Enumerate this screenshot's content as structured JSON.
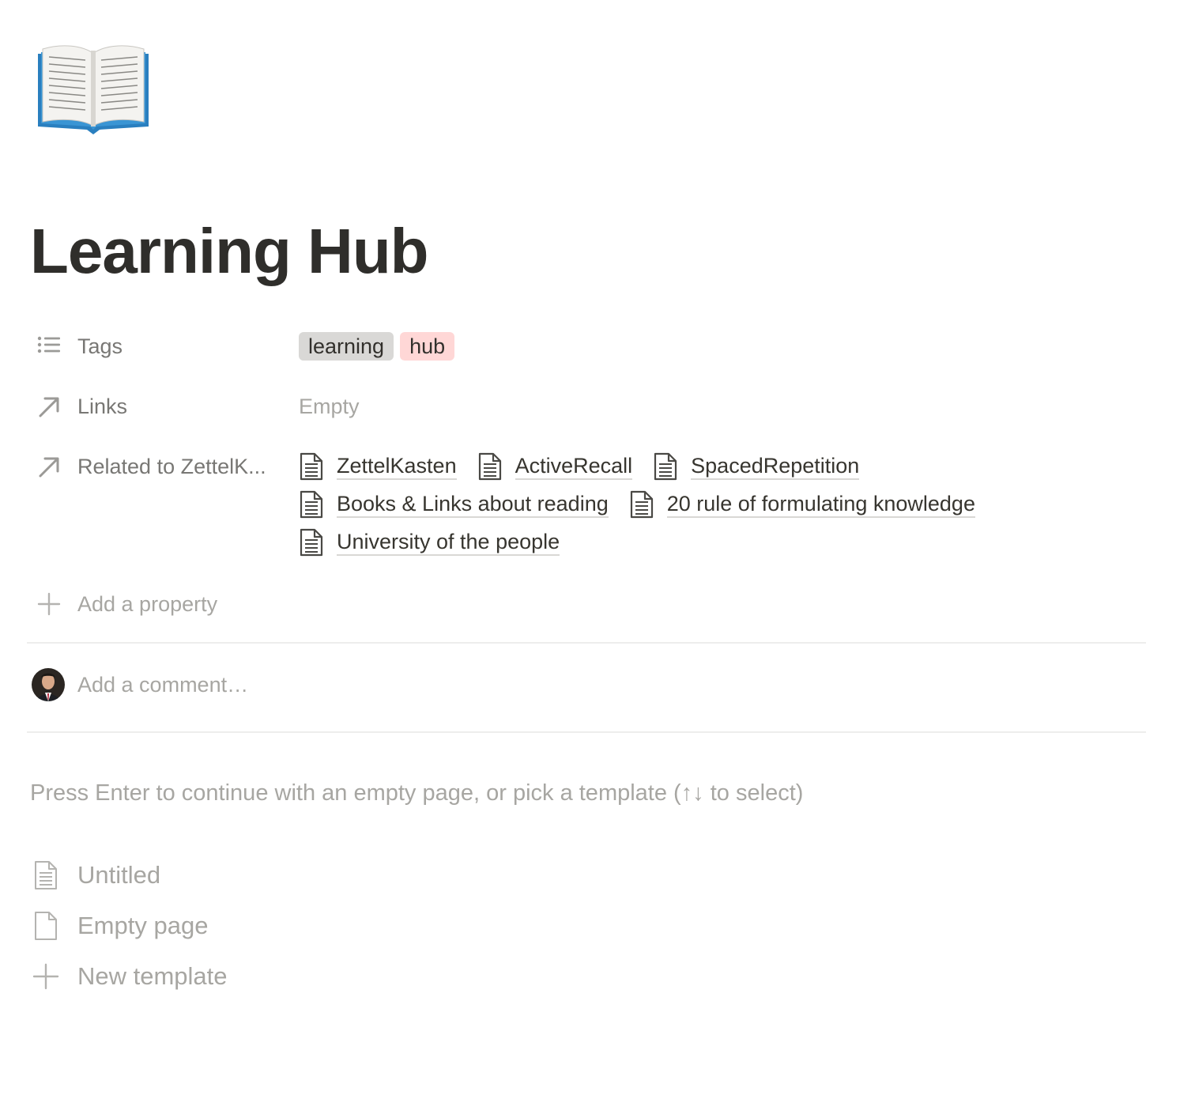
{
  "page": {
    "icon": "open-book-emoji",
    "title": "Learning Hub"
  },
  "properties": {
    "tags": {
      "label": "Tags",
      "icon": "list-icon",
      "values": [
        {
          "text": "learning",
          "color": "#e3e2e0"
        },
        {
          "text": "hub",
          "color": "#ffe2dd"
        }
      ]
    },
    "links": {
      "label": "Links",
      "icon": "arrow-up-right-icon",
      "value": "Empty"
    },
    "related": {
      "label": "Related to ZettelK...",
      "icon": "arrow-up-right-icon",
      "items": [
        "ZettelKasten",
        "ActiveRecall",
        "SpacedRepetition",
        "Books & Links about reading",
        "20 rule of formulating knowledge",
        "University of the people"
      ]
    },
    "add_property_label": "Add a property"
  },
  "comment": {
    "placeholder": "Add a comment…"
  },
  "hint": "Press Enter to continue with an empty page, or pick a template (↑↓ to select)",
  "templates": [
    {
      "label": "Untitled",
      "icon": "document-lines-icon"
    },
    {
      "label": "Empty page",
      "icon": "document-blank-icon"
    },
    {
      "label": "New template",
      "icon": "plus-icon"
    }
  ],
  "colors": {
    "text": "#37352f",
    "muted": "#787774",
    "placeholder": "#a7a6a2",
    "tag_gray": "#e3e2e0",
    "tag_red": "#ffe2dd"
  }
}
